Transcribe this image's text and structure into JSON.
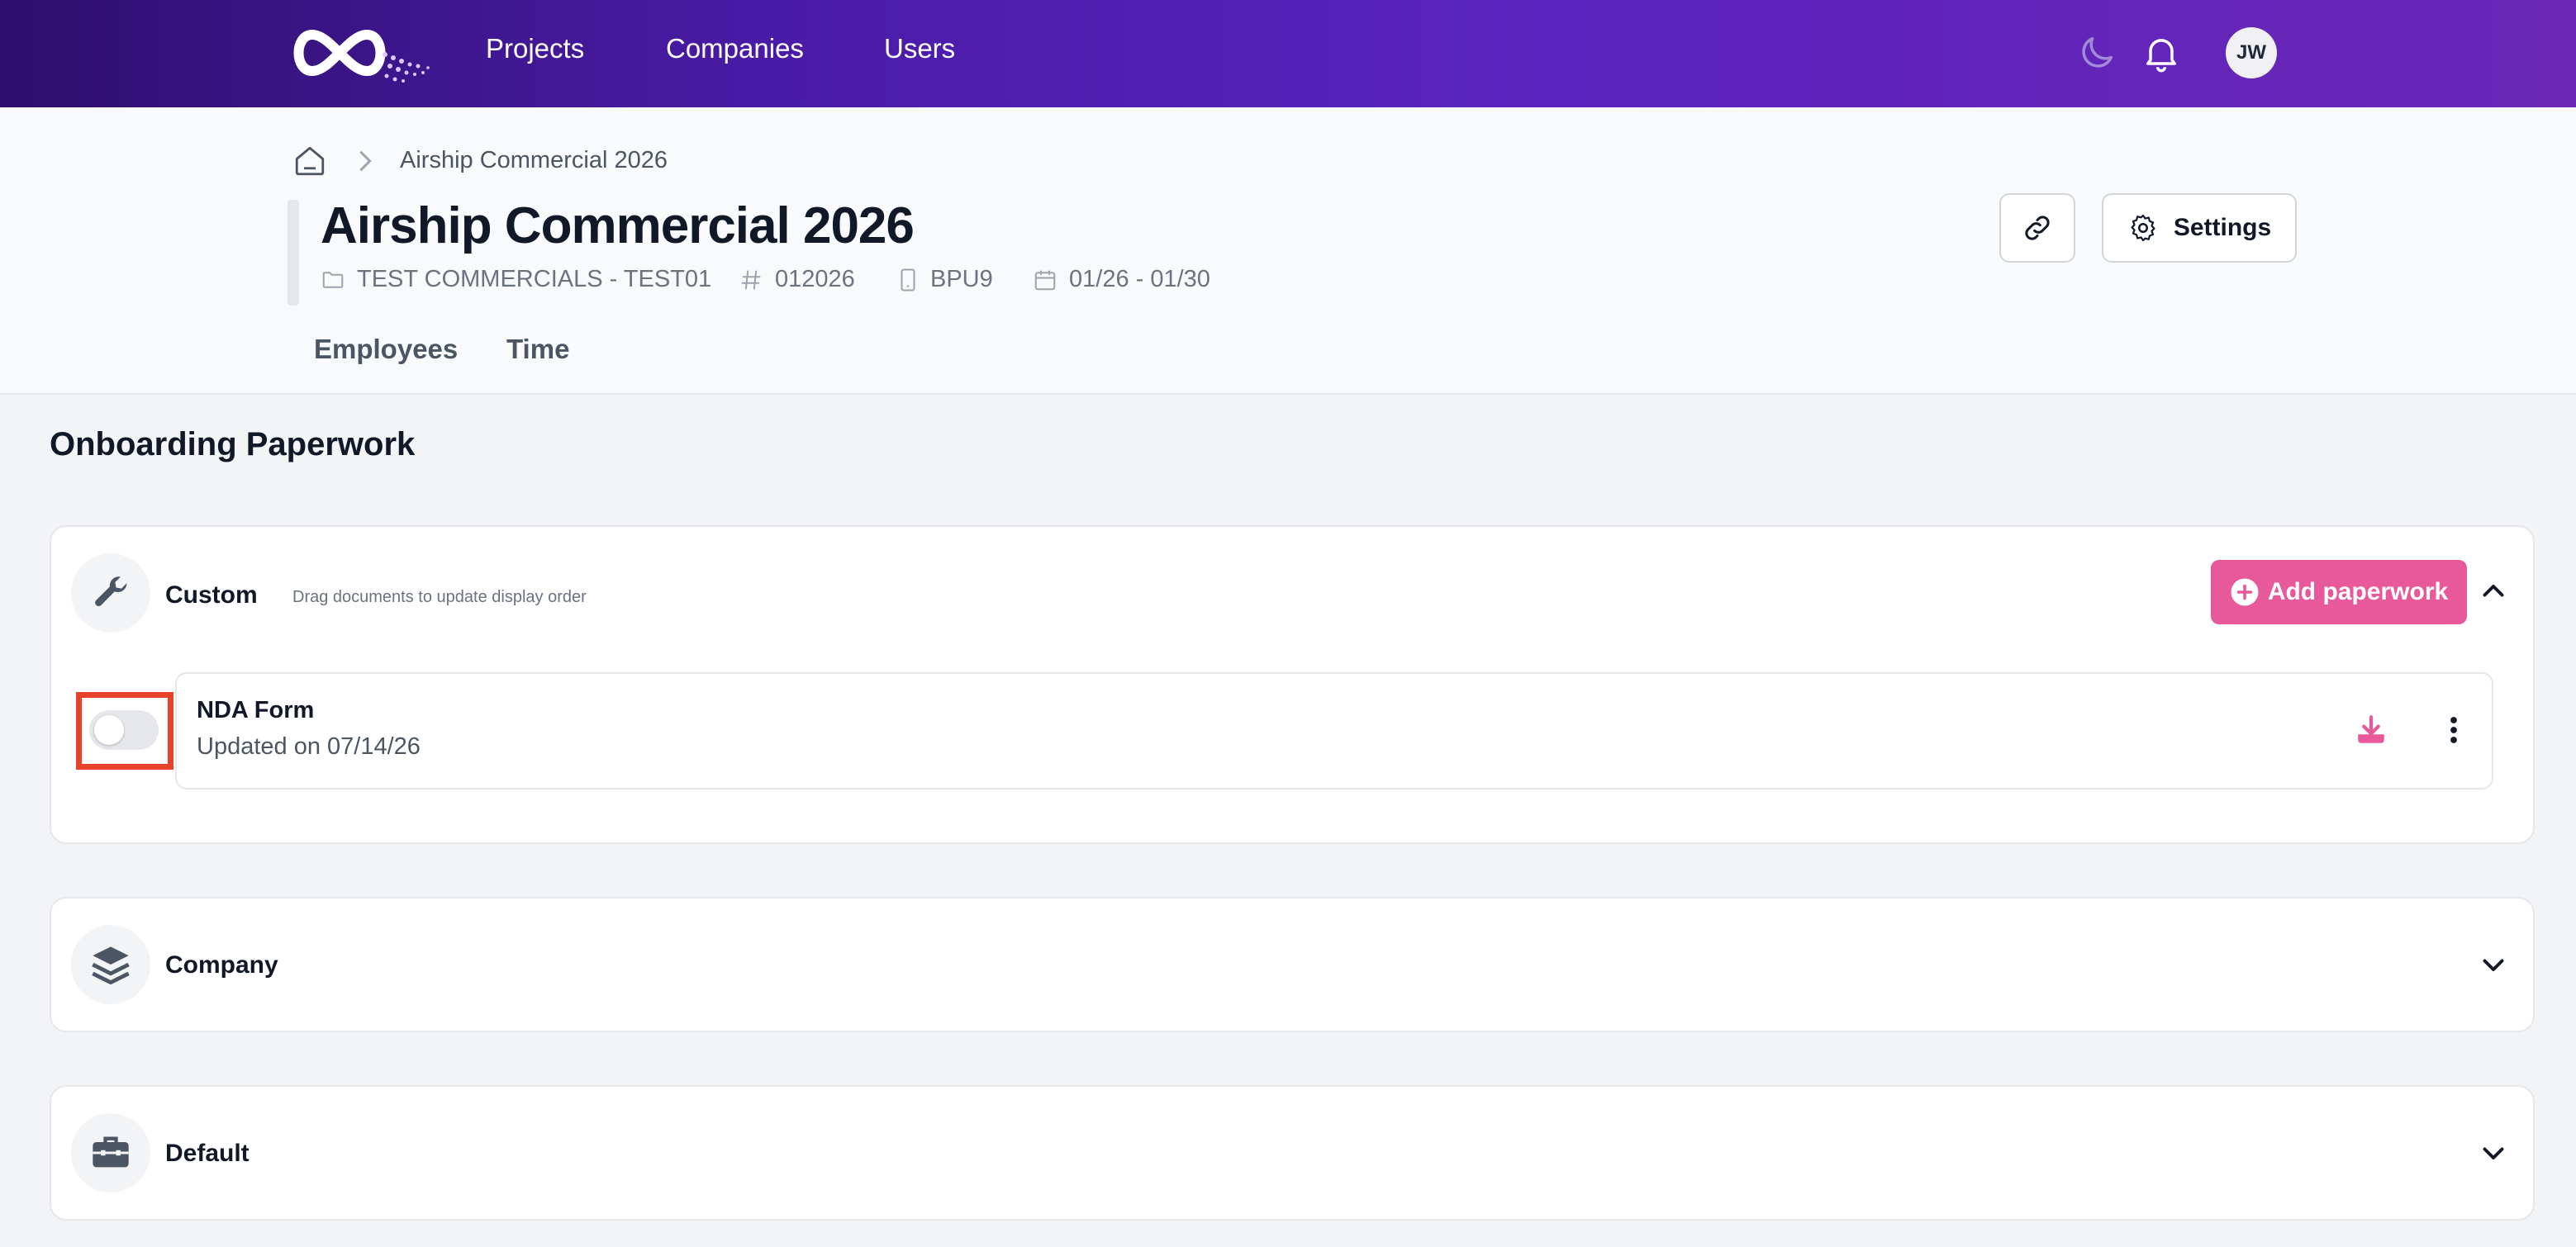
{
  "nav": {
    "links": [
      "Projects",
      "Companies",
      "Users"
    ],
    "avatar_initials": "JW",
    "icons": [
      "logo-infinity",
      "moon-icon",
      "bell-icon"
    ]
  },
  "breadcrumb": {
    "current": "Airship Commercial 2026"
  },
  "project": {
    "title": "Airship Commercial 2026",
    "meta": {
      "company": "TEST COMMERCIALS - TEST01",
      "number": "012026",
      "code": "BPU9",
      "dates": "01/26 - 01/30"
    }
  },
  "actions": {
    "settings_label": "Settings"
  },
  "tabs": [
    "Employees",
    "Time"
  ],
  "section": {
    "title": "Onboarding Paperwork"
  },
  "groups": {
    "custom": {
      "name": "Custom",
      "hint": "Drag documents to update display order",
      "add_label": "Add paperwork",
      "documents": [
        {
          "name": "NDA Form",
          "updated": "Updated on 07/14/26",
          "enabled": false
        }
      ]
    },
    "company": {
      "name": "Company"
    },
    "default": {
      "name": "Default"
    }
  },
  "colors": {
    "accent": "#e8599b",
    "nav_gradient_start": "#2e0f6e",
    "nav_gradient_end": "#6a27b6",
    "highlight": "#e8432a"
  }
}
